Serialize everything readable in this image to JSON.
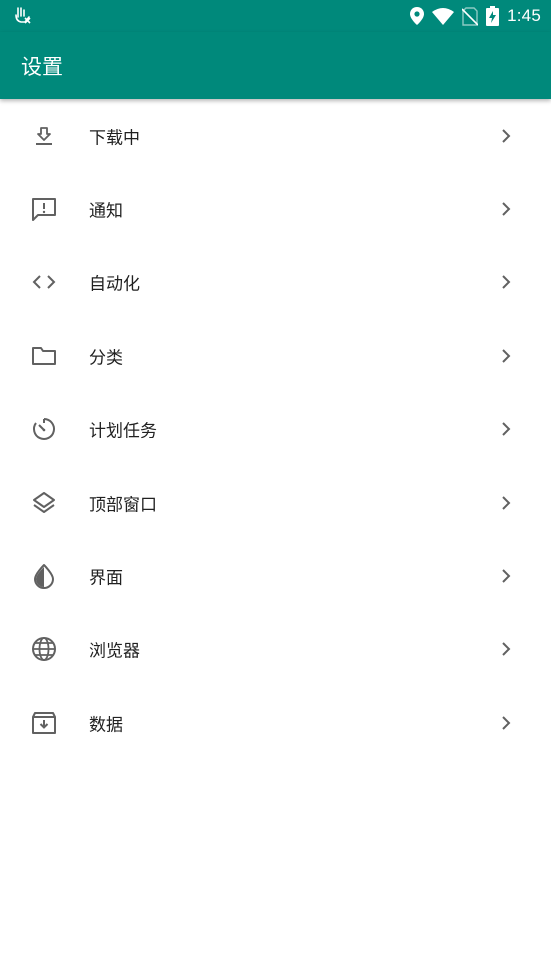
{
  "status_bar": {
    "time": "1:45"
  },
  "app_bar": {
    "title": "设置",
    "color": "#00897b"
  },
  "settings": {
    "items": [
      {
        "label": "下载中",
        "icon": "download-icon"
      },
      {
        "label": "通知",
        "icon": "notification-icon"
      },
      {
        "label": "自动化",
        "icon": "code-icon"
      },
      {
        "label": "分类",
        "icon": "folder-icon"
      },
      {
        "label": "计划任务",
        "icon": "timer-icon"
      },
      {
        "label": "顶部窗口",
        "icon": "layers-icon"
      },
      {
        "label": "界面",
        "icon": "contrast-icon"
      },
      {
        "label": "浏览器",
        "icon": "globe-icon"
      },
      {
        "label": "数据",
        "icon": "archive-icon"
      }
    ]
  }
}
